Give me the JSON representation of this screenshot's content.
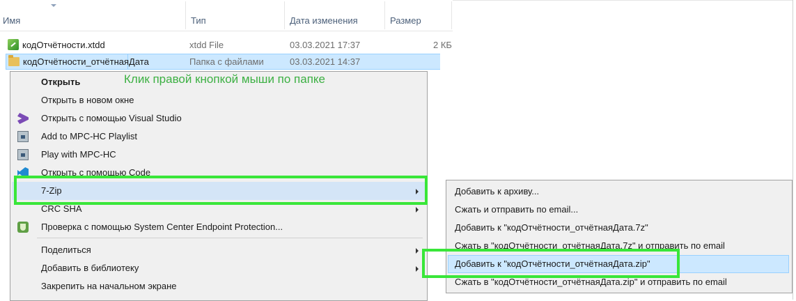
{
  "columns": {
    "name": "Имя",
    "type": "Тип",
    "date": "Дата изменения",
    "size": "Размер"
  },
  "files": [
    {
      "name": "кодОтчётности.xtdd",
      "type": "xtdd File",
      "date": "03.03.2021 17:37",
      "size": "2 КБ",
      "icon": "xtdd-file-icon"
    },
    {
      "name": "кодОтчётности_отчётнаяДата",
      "type": "Папка с файлами",
      "date": "03.03.2021 14:37",
      "size": "",
      "icon": "folder-icon",
      "selected": true
    }
  ],
  "annotation": "Клик правой кнопкой мыши по папке",
  "context_menu": {
    "items": [
      {
        "label": "Открыть",
        "bold": true
      },
      {
        "label": "Открыть в новом окне"
      },
      {
        "label": "Открыть с помощью Visual Studio",
        "icon": "visual-studio-icon"
      },
      {
        "label": "Add to MPC-HC Playlist",
        "icon": "mpc-hc-icon"
      },
      {
        "label": "Play with MPC-HC",
        "icon": "mpc-hc-icon"
      },
      {
        "label": "Открыть с помощью Code",
        "icon": "vscode-icon"
      },
      {
        "label": "7-Zip",
        "submenu": true,
        "highlighted": true
      },
      {
        "label": "CRC SHA",
        "submenu": true
      },
      {
        "label": "Проверка с помощью System Center Endpoint Protection...",
        "icon": "endpoint-protection-icon"
      },
      {
        "label": "Поделиться",
        "submenu": true
      },
      {
        "label": "Добавить в библиотеку",
        "submenu": true
      },
      {
        "label": "Закрепить на начальном экране"
      }
    ]
  },
  "submenu_7zip": {
    "items": [
      {
        "label": "Добавить к архиву..."
      },
      {
        "label": "Сжать и отправить по email..."
      },
      {
        "label": "Добавить к \"кодОтчётности_отчётнаяДата.7z\""
      },
      {
        "label": "Сжать в \"кодОтчётности_отчётнаяДата.7z\" и отправить по email"
      },
      {
        "label": "Добавить к \"кодОтчётности_отчётнаяДата.zip\"",
        "highlighted": true
      },
      {
        "label": "Сжать в \"кодОтчётности_отчётнаяДата.zip\" и отправить по email"
      }
    ]
  },
  "colors": {
    "annotation": "#3cb043",
    "highlight_box": "#39e639",
    "selection": "#cce8ff"
  }
}
